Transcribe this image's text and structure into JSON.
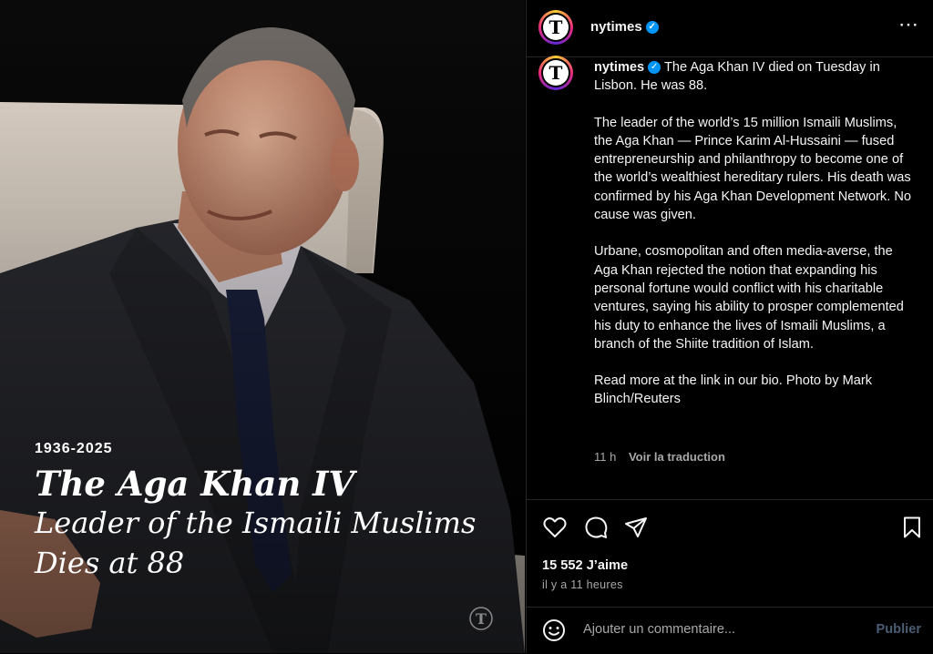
{
  "photo": {
    "years": "1936-2025",
    "headline": "The Aga Khan IV",
    "subhead_line1": "Leader of the Ismaili Muslims",
    "subhead_line2": "Dies at 88"
  },
  "header": {
    "username": "nytimes",
    "avatar_letter": "T",
    "more_icon": "⋯"
  },
  "caption": {
    "username": "nytimes",
    "paragraphs": [
      "The Aga Khan IV died on Tuesday in Lisbon. He was 88.",
      "The leader of the world’s 15 million Ismaili Muslims, the Aga Khan — Prince Karim Al-Hussaini — fused entrepreneurship and philanthropy to become one of the world’s wealthiest hereditary rulers. His death was confirmed by his Aga Khan Development Network. No cause was given.",
      "Urbane, cosmopolitan and often media-averse, the Aga Khan rejected the notion that expanding his personal fortune would conflict with his charitable ventures, saying his ability to prosper complemented his duty to enhance the lives of Ismaili Muslims, a branch of the Shiite tradition of Islam.",
      "Read more at the link in our bio. Photo by Mark Blinch/Reuters"
    ],
    "age": "11 h",
    "translate": "Voir la traduction"
  },
  "actions": {
    "likes": "15 552 J’aime",
    "time": "il y a 11 heures"
  },
  "comment": {
    "placeholder": "Ajouter un commentaire...",
    "publish": "Publier"
  },
  "colors": {
    "accent": "#0095f6",
    "background": "#000000",
    "muted": "#a8a8a8",
    "publish_disabled": "#4a5d74"
  }
}
